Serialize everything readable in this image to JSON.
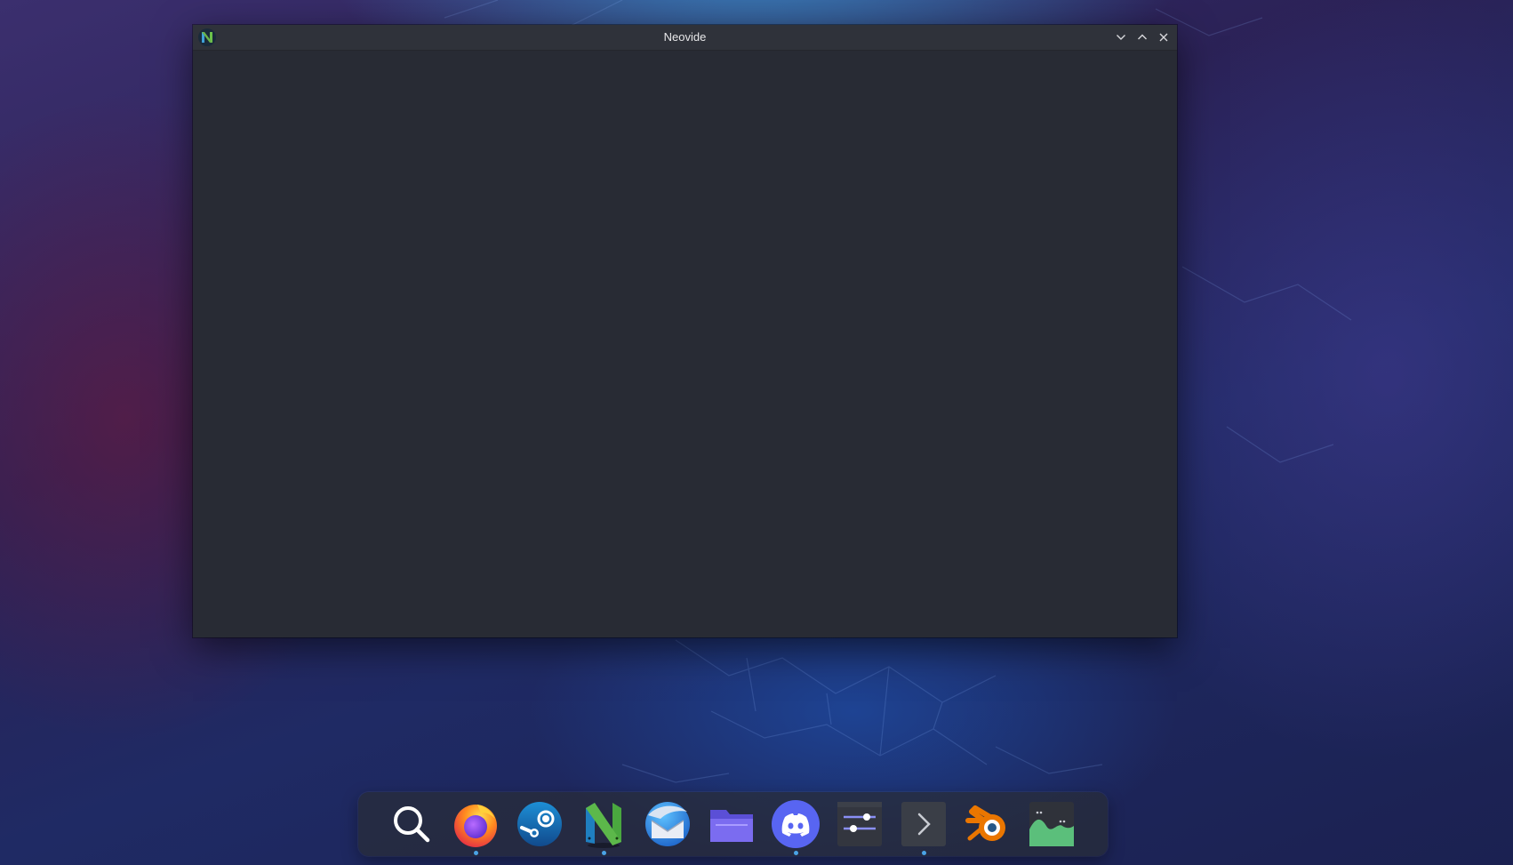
{
  "window": {
    "title": "Neovide",
    "app_icon": "neovim-icon",
    "controls": {
      "minimize": "chevron-down-icon",
      "maximize": "chevron-up-icon",
      "close": "close-icon"
    }
  },
  "dock": {
    "items": [
      {
        "name": "search",
        "icon": "search-icon",
        "running": false
      },
      {
        "name": "firefox",
        "icon": "firefox-icon",
        "running": true
      },
      {
        "name": "steam",
        "icon": "steam-icon",
        "running": false
      },
      {
        "name": "neovide",
        "icon": "neovim-icon",
        "running": true
      },
      {
        "name": "thunderbird",
        "icon": "thunderbird-icon",
        "running": false
      },
      {
        "name": "files",
        "icon": "folder-icon",
        "running": false
      },
      {
        "name": "discord",
        "icon": "discord-icon",
        "running": true
      },
      {
        "name": "settings",
        "icon": "sliders-icon",
        "running": false
      },
      {
        "name": "terminal",
        "icon": "terminal-icon",
        "running": true
      },
      {
        "name": "blender",
        "icon": "blender-icon",
        "running": false
      },
      {
        "name": "system-monitor",
        "icon": "system-monitor-icon",
        "running": false
      }
    ]
  },
  "colors": {
    "window_bg": "#282b34",
    "titlebar_bg": "#2f323a",
    "running_indicator": "#4aa3e6"
  }
}
